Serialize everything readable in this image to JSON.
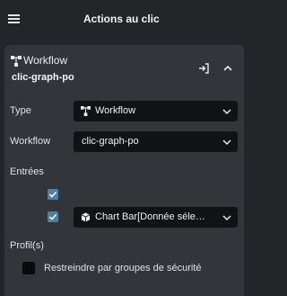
{
  "header": {
    "title": "Actions au clic",
    "menu_icon": "hamburger-icon"
  },
  "panel": {
    "type_label": "Workflow",
    "name": "clic-graph-po",
    "icons": {
      "type": "workflow-icon",
      "enter": "enter-icon",
      "collapse": "chevron-up-icon"
    }
  },
  "form": {
    "type": {
      "label": "Type",
      "value": "Workflow",
      "icon": "workflow-icon"
    },
    "workflow": {
      "label": "Workflow",
      "value": "clic-graph-po"
    },
    "entries": {
      "label": "Entrées",
      "items": [
        {
          "checked": true
        },
        {
          "checked": true,
          "value": "Chart Bar[Donnée séle…",
          "icon": "cube-icon"
        }
      ]
    },
    "profiles": {
      "label": "Profil(s)",
      "restrict_label": "Restreindre par groupes de sécurité",
      "restrict_checked": false
    }
  },
  "colors": {
    "accent": "#4f7fa5",
    "panel": "#323539",
    "background": "#232528",
    "field": "#111214"
  }
}
